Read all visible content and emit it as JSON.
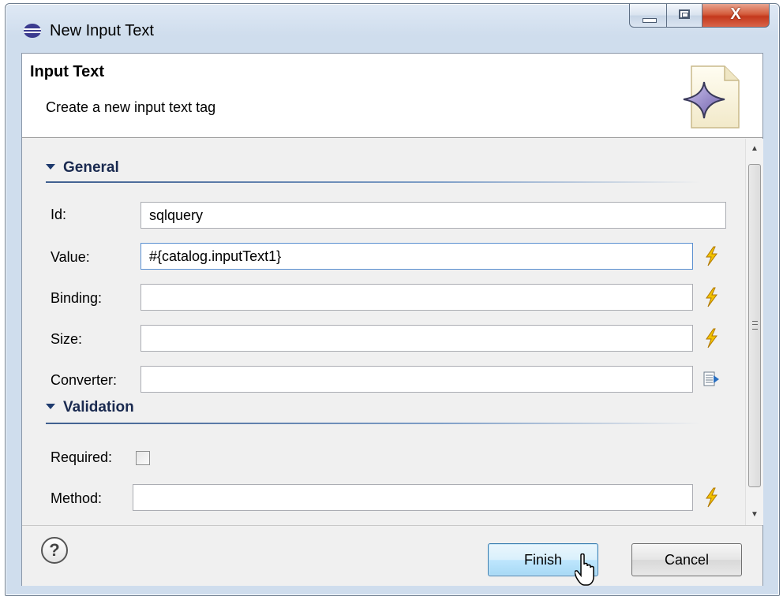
{
  "window": {
    "title": "New Input Text",
    "minimize_icon": "minimize-icon",
    "maximize_icon": "maximize-icon",
    "close_label": "X"
  },
  "banner": {
    "title": "Input Text",
    "description": "Create a new input text tag",
    "icon": "jsf-wizard-icon"
  },
  "sections": {
    "general": {
      "label": "General",
      "fields": {
        "id": {
          "label": "Id:",
          "value": "sqlquery"
        },
        "value": {
          "label": "Value:",
          "value": "#{catalog.inputText1}"
        },
        "binding": {
          "label": "Binding:",
          "value": ""
        },
        "size": {
          "label": "Size:",
          "value": ""
        },
        "converter": {
          "label": "Converter:",
          "value": ""
        }
      }
    },
    "validation": {
      "label": "Validation",
      "fields": {
        "required": {
          "label": "Required:",
          "checked": false
        },
        "method": {
          "label": "Method:",
          "value": ""
        }
      }
    }
  },
  "footer": {
    "help_label": "?",
    "finish_label": "Finish",
    "cancel_label": "Cancel"
  },
  "colors": {
    "section_heading": "#1a2a50",
    "default_button": "#bee6fd",
    "close_button": "#c4381c",
    "bolt": "#f0b400"
  }
}
